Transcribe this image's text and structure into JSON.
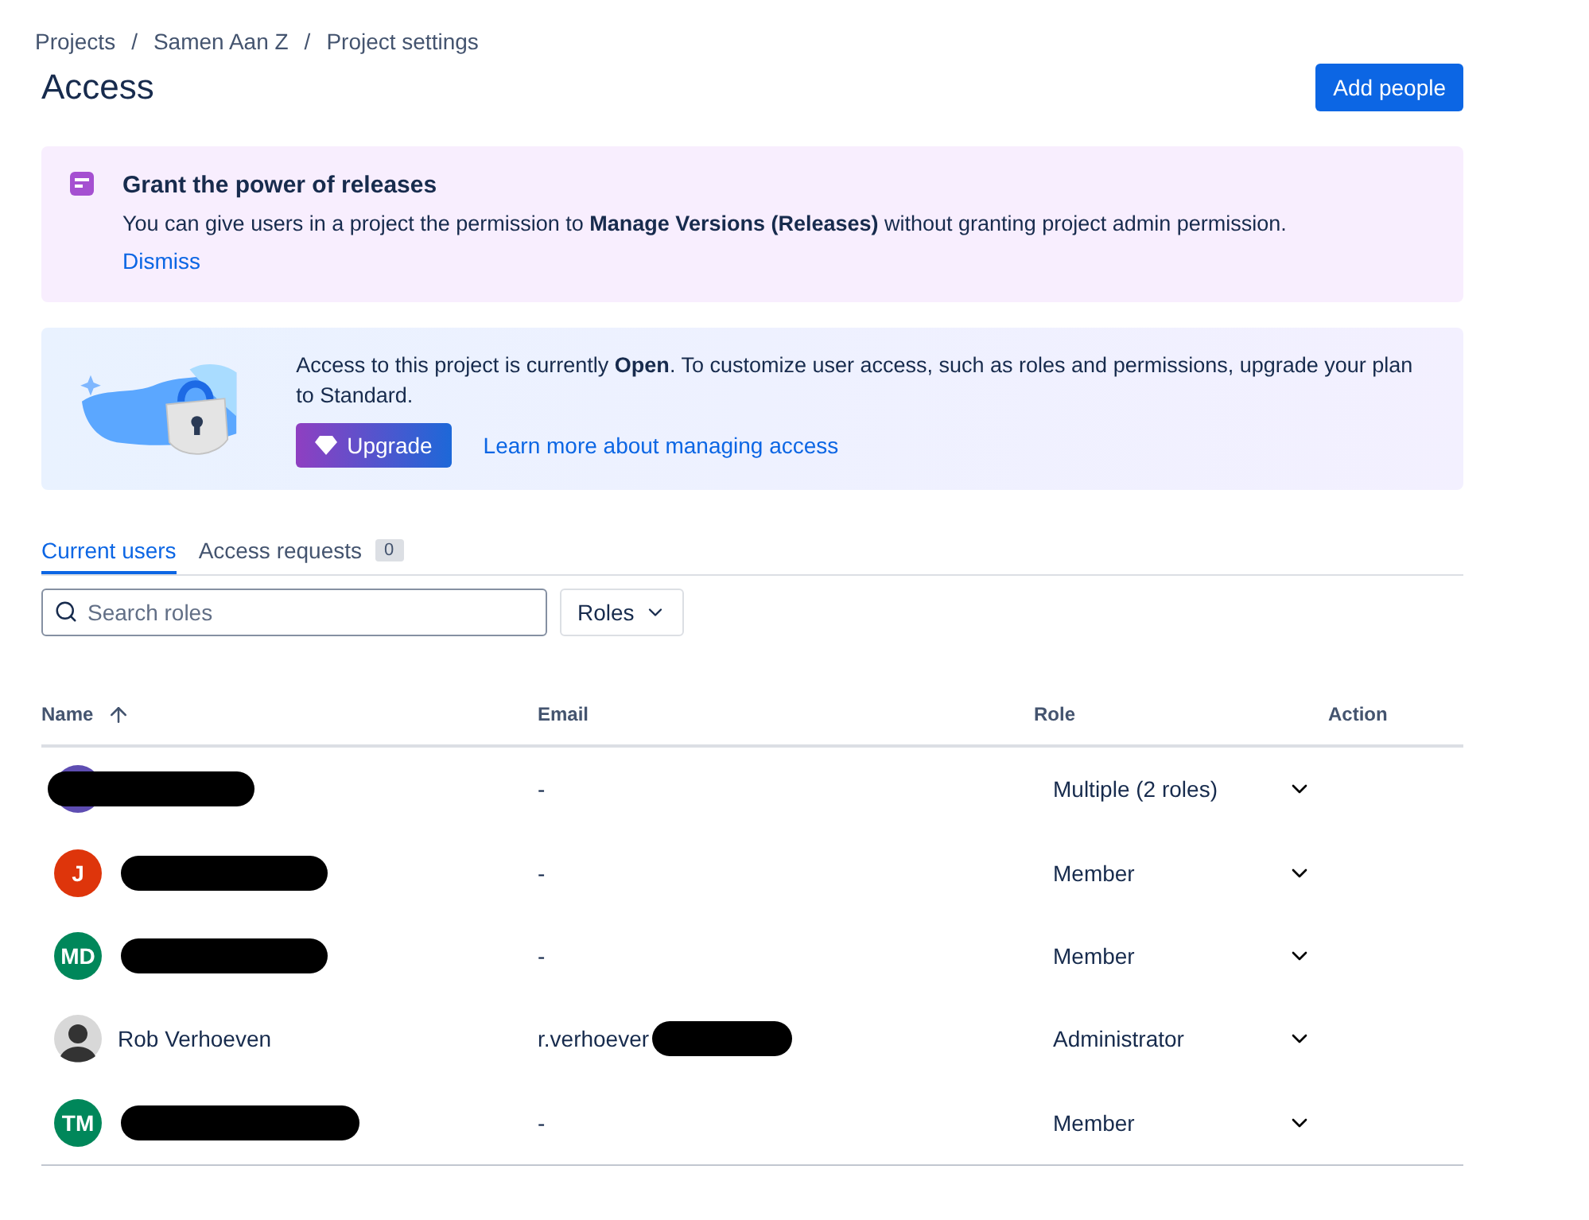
{
  "breadcrumbs": [
    "Projects",
    "Samen Aan Z",
    "Project settings"
  ],
  "breadcrumb_separator": "/",
  "title": "Access",
  "add_button": "Add people",
  "notice": {
    "title": "Grant the power of releases",
    "text": "You can give users in a project the permission to **Manage Versions (Releases)** without granting project admin permission.",
    "link": "Dismiss"
  },
  "upsell": {
    "text": "Access to this project is currently **Open**. To customize user access, such as roles and permissions, upgrade your plan to Standard.",
    "button": "Upgrade",
    "link": "Learn more about managing access"
  },
  "tabs": [
    {
      "label": "Current users",
      "selected": true
    },
    {
      "label": "Access requests",
      "selected": false,
      "count": "0"
    }
  ],
  "search": {
    "placeholder": "Search roles"
  },
  "roles_filter": "Roles",
  "table": {
    "columns": [
      "Name",
      "Email",
      "Role",
      "Action"
    ],
    "rows": [
      {
        "avatar": {
          "kind": "initials",
          "color": "#5e4db2"
        },
        "name_redacted": true,
        "email": "-",
        "role": "Multiple (2 roles)"
      },
      {
        "avatar": {
          "kind": "initials",
          "initials": "J",
          "color": "#de350b"
        },
        "name_redacted": true,
        "email": "-",
        "role": "Member"
      },
      {
        "avatar": {
          "kind": "initials",
          "initials": "MD",
          "color": "#00875a"
        },
        "name_redacted": true,
        "email": "-",
        "role": "Member"
      },
      {
        "avatar": {
          "kind": "photo"
        },
        "name": "Rob Verhoeven",
        "email": "r.verhoever",
        "email_redacted": true,
        "role": "Administrator"
      },
      {
        "avatar": {
          "kind": "initials",
          "initials": "TM",
          "color": "#00875a"
        },
        "name_redacted": true,
        "email": "-",
        "role": "Member"
      }
    ]
  }
}
